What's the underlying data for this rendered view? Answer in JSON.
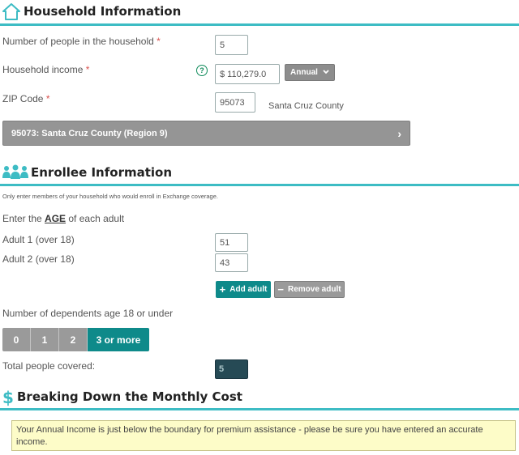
{
  "household": {
    "title": "Household Information",
    "people_label": "Number of people in the household",
    "required_mark": "*",
    "people_value": "5",
    "income_label": "Household income",
    "help_icon": "?",
    "income_value": "$ 110,279.0",
    "frequency_value": "Annual",
    "zip_label": "ZIP Code",
    "zip_value": "95073",
    "county_text": "Santa Cruz County",
    "region_button": "95073: Santa Cruz County (Region 9)",
    "region_chevron": "›"
  },
  "enrollee": {
    "title": "Enrollee Information",
    "note": "Only enter members of your household who would enroll in Exchange coverage.",
    "age_prompt_pre": "Enter the ",
    "age_prompt_em": "AGE",
    "age_prompt_post": " of each adult",
    "adults": [
      {
        "label": "Adult 1 (over 18)",
        "value": "51"
      },
      {
        "label": "Adult 2 (over 18)",
        "value": "43"
      }
    ],
    "add_adult": "Add adult",
    "add_icon": "+",
    "remove_adult": "Remove adult",
    "remove_icon": "−",
    "dependents_label": "Number of dependents age 18 or under",
    "dependent_options": [
      "0",
      "1",
      "2",
      "3 or more"
    ],
    "dependent_selected": "3 or more",
    "total_label": "Total people covered:",
    "total_value": "5"
  },
  "cost": {
    "icon": "$",
    "title": "Breaking Down the Monthly Cost",
    "warning": "Your Annual Income is just below the boundary for premium assistance - please be sure you have entered an accurate income."
  },
  "colors": {
    "accent": "#3dbcc4",
    "teal_button": "#0e8a8a",
    "gray_button": "#9a9a9a",
    "warning_bg": "#fdfcc8"
  }
}
